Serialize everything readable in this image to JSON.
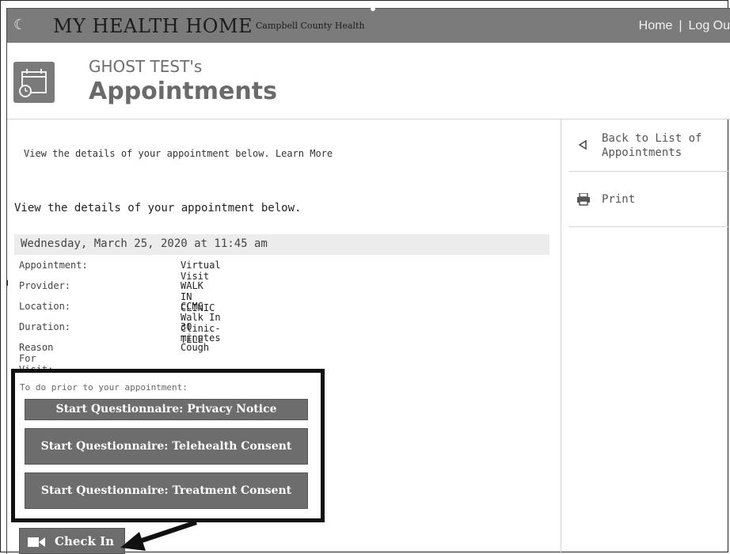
{
  "topbar": {
    "logo_glyph": "☾",
    "brand": "MY HEALTH HOME",
    "brand_sub": "Campbell County Health",
    "nav_home": "Home",
    "nav_sep": "|",
    "nav_logout": "Log Ou"
  },
  "header": {
    "owner": "GHOST TEST's",
    "title": "Appointments",
    "icon": "calendar-clock-icon"
  },
  "main": {
    "intro": "View the details of your appointment below. Learn More",
    "lead": "View the details of your appointment below.",
    "date": "Wednesday, March 25, 2020 at 11:45 am",
    "details": [
      {
        "label": "Appointment:",
        "value": "Virtual Visit"
      },
      {
        "label": "Provider:",
        "value": "WALK IN CLINIC"
      },
      {
        "label": "Location:",
        "value": "CCMG Walk In Clinic-TELE"
      },
      {
        "label": "Duration:",
        "value": "30 minutes"
      },
      {
        "label": "Reason For Visit:",
        "value": "Cough"
      }
    ],
    "todo_label": "To do prior to your appointment:",
    "questionnaires": [
      "Start Questionnaire: Privacy Notice",
      "Start Questionnaire: Telehealth Consent",
      "Start Questionnaire: Treatment Consent"
    ],
    "checkin_label": "Check In"
  },
  "sidebar": {
    "back_label": "Back to List of Appointments",
    "print_label": "Print"
  },
  "colors": {
    "topbar": "#7b7b7b",
    "button": "#6d6d6d",
    "date_bar": "#ececec"
  }
}
